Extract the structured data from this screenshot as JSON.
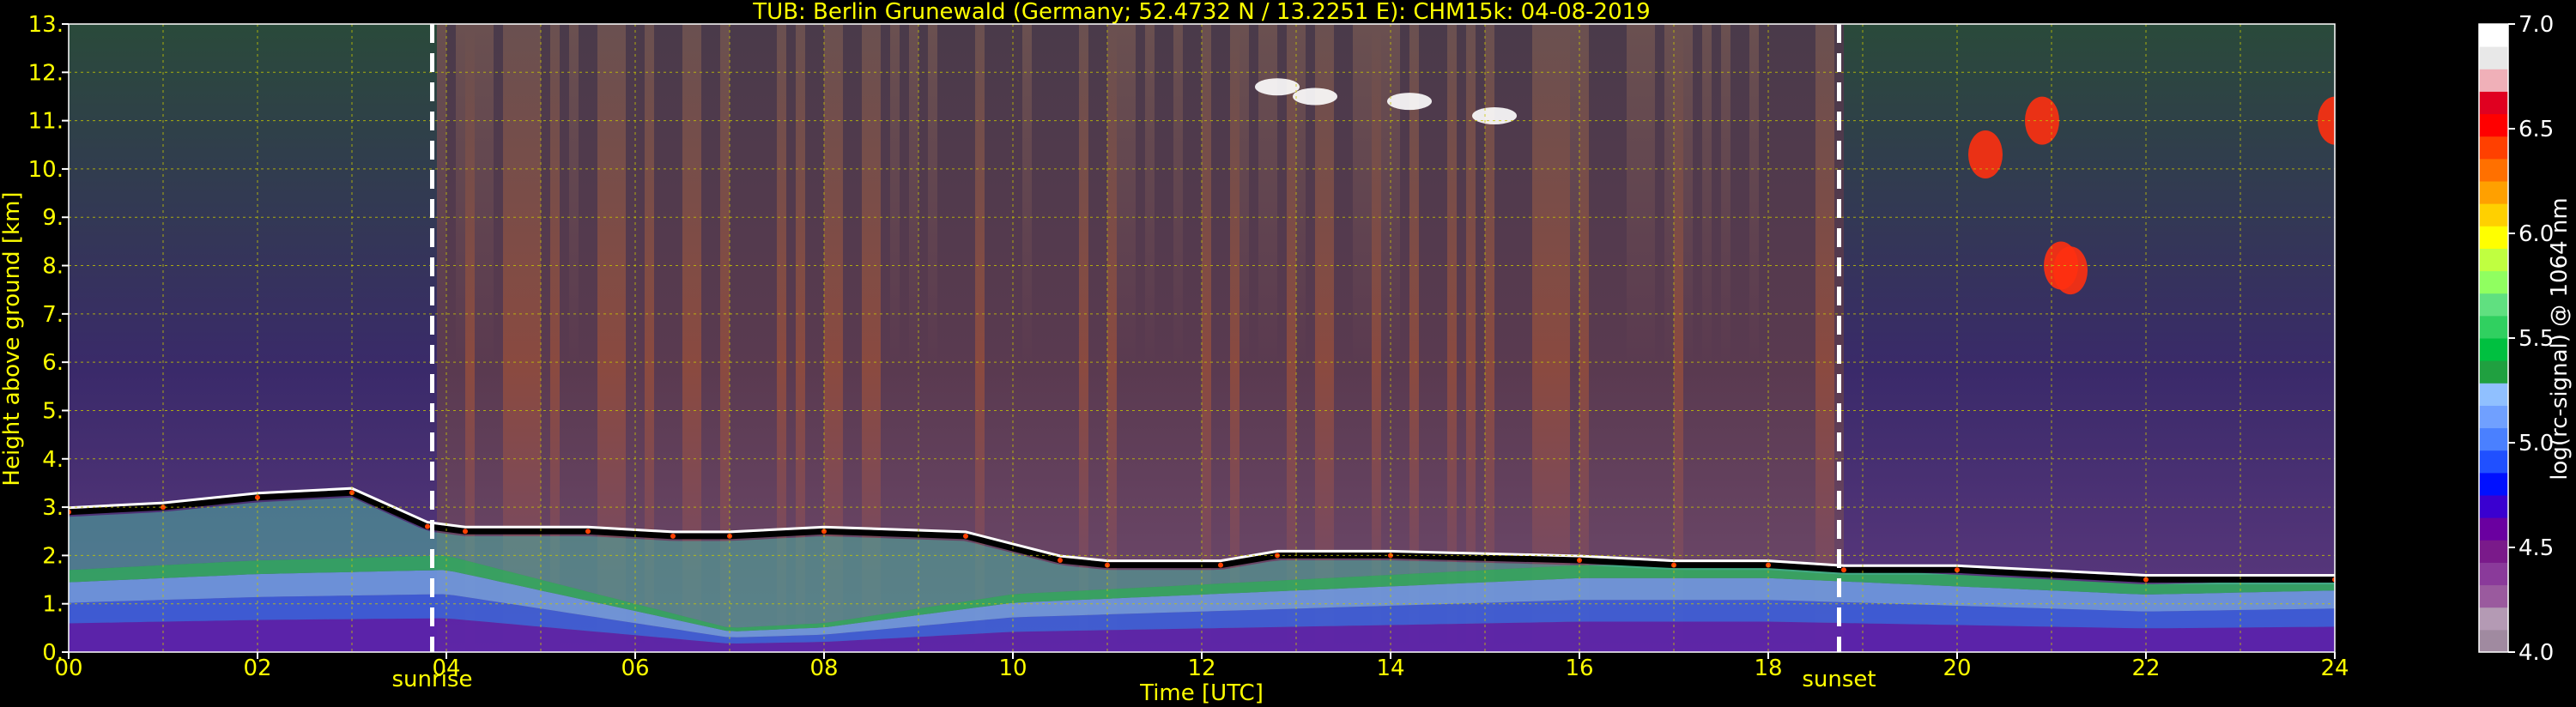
{
  "chart_data": {
    "type": "heatmap",
    "title": "TUB: Berlin Grunewald (Germany; 52.4732 N / 13.2251 E):    CHM15k: 04-08-2019",
    "xlabel": "Time [UTC]",
    "ylabel": "Height above ground [km]",
    "xlim": [
      0,
      24
    ],
    "ylim": [
      0,
      13
    ],
    "x_ticks": [
      "00",
      "02",
      "04",
      "06",
      "08",
      "10",
      "12",
      "14",
      "16",
      "18",
      "20",
      "22",
      "24"
    ],
    "y_ticks": [
      "0.",
      "1.",
      "2.",
      "3.",
      "4.",
      "5.",
      "6.",
      "7.",
      "8.",
      "9.",
      "10.",
      "11.",
      "12.",
      "13."
    ],
    "grid": true,
    "annotations": [
      {
        "label": "sunrise",
        "time": 3.85
      },
      {
        "label": "sunset",
        "time": 18.75
      }
    ],
    "colorbar": {
      "label": "log(rc-signal) @ 1064 nm",
      "range": [
        4.0,
        7.0
      ],
      "ticks": [
        "4.0",
        "4.5",
        "5.0",
        "5.5",
        "6.0",
        "6.5",
        "7.0"
      ],
      "colors": [
        "#a08aa0",
        "#b49ab4",
        "#9a5a9e",
        "#8a3a9a",
        "#7a1a8a",
        "#6a00a0",
        "#3a00d0",
        "#0010ff",
        "#2050ff",
        "#4a80ff",
        "#70a0ff",
        "#90c0ff",
        "#20a040",
        "#00c040",
        "#30d060",
        "#60e080",
        "#90ff60",
        "#c0ff40",
        "#ffff00",
        "#ffd000",
        "#ffa000",
        "#ff7000",
        "#ff4000",
        "#ff0000",
        "#e00020",
        "#f0b0b8",
        "#e8e8e8",
        "#ffffff"
      ]
    },
    "series": [
      {
        "name": "cloud_top",
        "x": [
          0,
          1,
          2,
          3,
          3.8,
          4.2,
          5.5,
          6.4,
          7.0,
          8.0,
          9.5,
          10.5,
          11.0,
          12.2,
          12.8,
          14,
          16,
          17,
          18,
          18.8,
          20,
          22,
          24
        ],
        "y": [
          2.9,
          3.0,
          3.2,
          3.3,
          2.6,
          2.5,
          2.5,
          2.4,
          2.4,
          2.5,
          2.4,
          1.9,
          1.8,
          1.8,
          2.0,
          2.0,
          1.9,
          1.8,
          1.8,
          1.7,
          1.7,
          1.5,
          1.5
        ]
      },
      {
        "name": "boundary_layer",
        "x": [
          0,
          2,
          4,
          6,
          7,
          8,
          10,
          12,
          14,
          16,
          18,
          19,
          20,
          22,
          24
        ],
        "y": [
          1.7,
          1.9,
          2.0,
          1.0,
          0.5,
          0.6,
          1.2,
          1.4,
          1.6,
          1.8,
          1.8,
          1.7,
          1.6,
          1.4,
          1.5
        ]
      },
      {
        "name": "cirrus_cells",
        "x": [
          12.8,
          13.2,
          14.2,
          15.1,
          20.9,
          21.1,
          21.2,
          20.3,
          24
        ],
        "y": [
          11.7,
          11.5,
          11.4,
          11.1,
          11.0,
          8.0,
          7.9,
          10.3,
          11.0
        ]
      }
    ]
  }
}
